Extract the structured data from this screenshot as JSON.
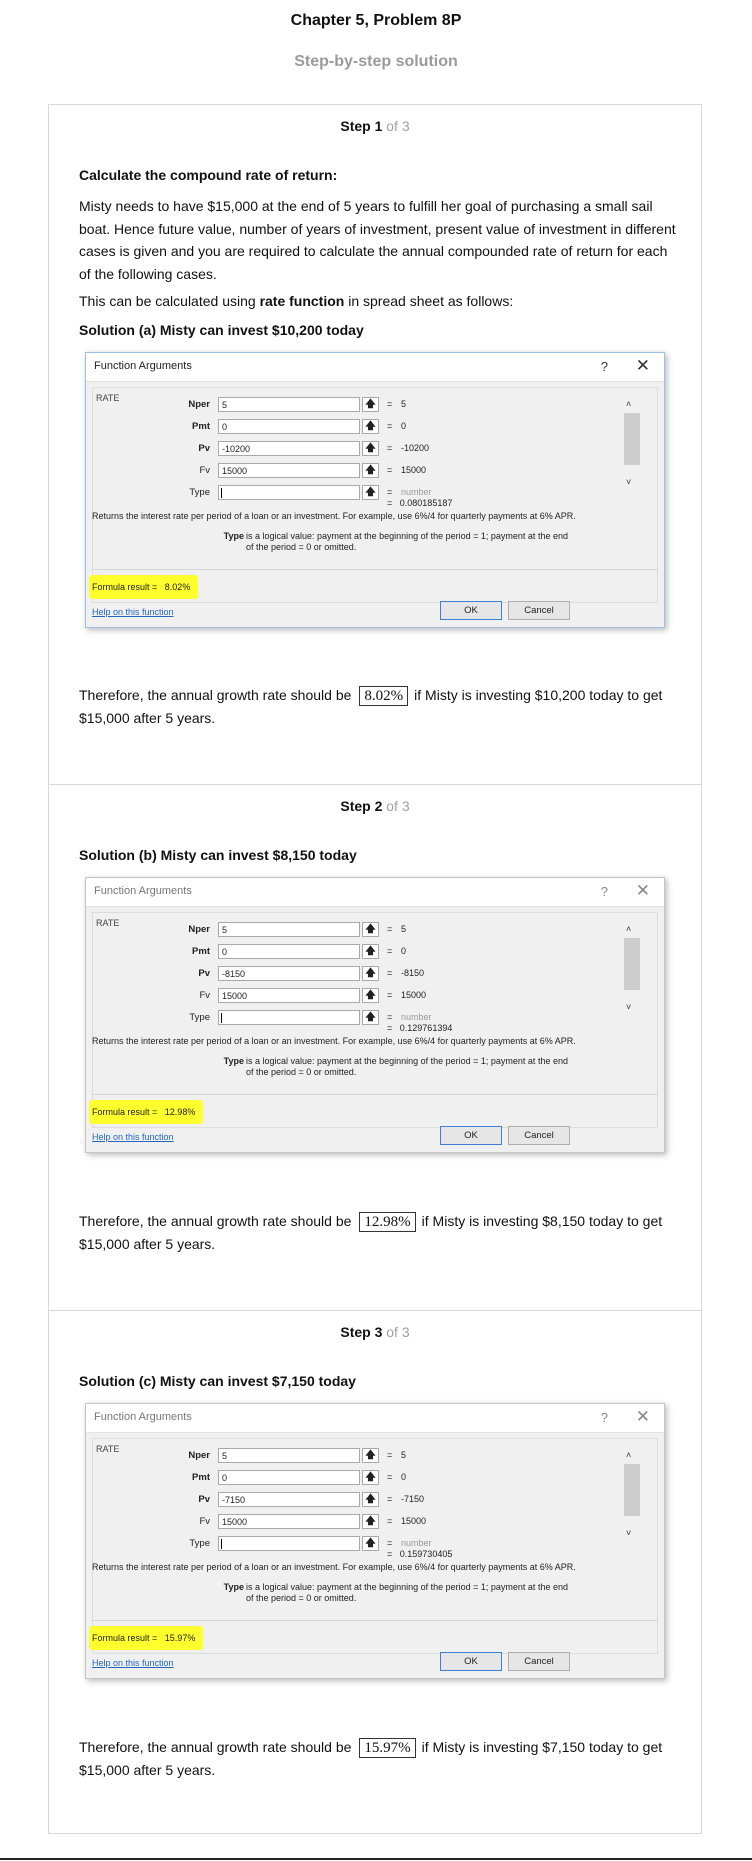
{
  "header": {
    "title": "Chapter 5, Problem 8P",
    "subtitle": "Step-by-step solution"
  },
  "step1": {
    "heading": "Step 1",
    "of": " of 3",
    "section_title": "Calculate the compound rate of return:",
    "intro": "Misty needs to have $15,000 at the end of 5 years to fulfill her goal of purchasing a small sail boat. Hence future value, number of years of investment, present value of investment in different cases is given and you are required to calculate the annual compounded rate of return for each of the following cases.",
    "method_before": "This can be calculated using ",
    "method_bold": "rate function",
    "method_after": " in spread sheet as follows:",
    "solution_title": "Solution (a) Misty can invest $10,200 today",
    "dialog": {
      "title": "Function Arguments",
      "help_glyph": "?",
      "close_glyph": "✕",
      "function_name": "RATE",
      "args": [
        {
          "label": "Nper",
          "value": "5",
          "result": "5"
        },
        {
          "label": "Pmt",
          "value": "0",
          "result": "0"
        },
        {
          "label": "Pv",
          "value": "-10200",
          "result": "-10200"
        },
        {
          "label": "Fv",
          "value": "15000",
          "result": "15000"
        },
        {
          "label": "Type",
          "value": "",
          "result": "number"
        }
      ],
      "equals": "=",
      "result_value": "0.080185187",
      "description": "Returns the interest rate per period of a loan or an investment. For example, use 6%/4 for quarterly payments at 6% APR.",
      "arg_name": "Type",
      "arg_description": "is a logical value: payment at the beginning of the period = 1; payment at the end of the period = 0 or omitted.",
      "formula_result_label": "Formula result =",
      "formula_result": "8.02%",
      "help_link": "Help on this function",
      "ok": "OK",
      "cancel": "Cancel"
    },
    "conclusion_before": "Therefore, the annual growth rate should be",
    "answer": "8.02%",
    "conclusion_after": "if Misty is investing $10,200 today to get $15,000 after 5 years."
  },
  "step2": {
    "heading": "Step 2",
    "of": " of 3",
    "solution_title": "Solution (b) Misty can invest $8,150 today",
    "dialog": {
      "title": "Function Arguments",
      "help_glyph": "?",
      "close_glyph": "✕",
      "function_name": "RATE",
      "args": [
        {
          "label": "Nper",
          "value": "5",
          "result": "5"
        },
        {
          "label": "Pmt",
          "value": "0",
          "result": "0"
        },
        {
          "label": "Pv",
          "value": "-8150",
          "result": "-8150"
        },
        {
          "label": "Fv",
          "value": "15000",
          "result": "15000"
        },
        {
          "label": "Type",
          "value": "",
          "result": "number"
        }
      ],
      "equals": "=",
      "result_value": "0.129761394",
      "description": "Returns the interest rate per period of a loan or an investment. For example, use 6%/4 for quarterly payments at 6% APR.",
      "arg_name": "Type",
      "arg_description": "is a logical value: payment at the beginning of the period = 1; payment at the end of the period = 0 or omitted.",
      "formula_result_label": "Formula result =",
      "formula_result": "12.98%",
      "help_link": "Help on this function",
      "ok": "OK",
      "cancel": "Cancel"
    },
    "conclusion_before": "Therefore, the annual growth rate should be",
    "answer": "12.98%",
    "conclusion_after": "if Misty is investing $8,150 today to get $15,000 after 5 years."
  },
  "step3": {
    "heading": "Step 3",
    "of": " of 3",
    "solution_title": "Solution (c) Misty can invest $7,150 today",
    "dialog": {
      "title": "Function Arguments",
      "help_glyph": "?",
      "close_glyph": "✕",
      "function_name": "RATE",
      "args": [
        {
          "label": "Nper",
          "value": "5",
          "result": "5"
        },
        {
          "label": "Pmt",
          "value": "0",
          "result": "0"
        },
        {
          "label": "Pv",
          "value": "-7150",
          "result": "-7150"
        },
        {
          "label": "Fv",
          "value": "15000",
          "result": "15000"
        },
        {
          "label": "Type",
          "value": "",
          "result": "number"
        }
      ],
      "equals": "=",
      "result_value": "0.159730405",
      "description": "Returns the interest rate per period of a loan or an investment. For example, use 6%/4 for quarterly payments at 6% APR.",
      "arg_name": "Type",
      "arg_description": "is a logical value: payment at the beginning of the period = 1; payment at the end of the period = 0 or omitted.",
      "formula_result_label": "Formula result =",
      "formula_result": "15.97%",
      "help_link": "Help on this function",
      "ok": "OK",
      "cancel": "Cancel"
    },
    "conclusion_before": "Therefore, the annual growth rate should be",
    "answer": "15.97%",
    "conclusion_after": "if Misty is investing $7,150 today to get $15,000 after 5 years."
  }
}
